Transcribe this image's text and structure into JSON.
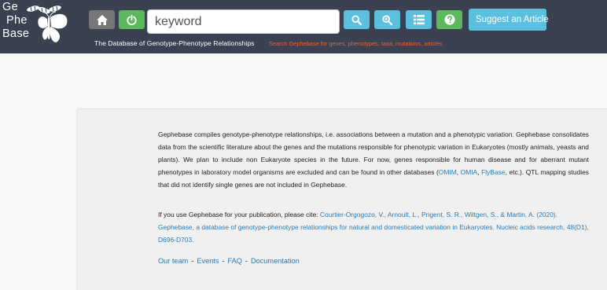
{
  "logo": {
    "line1": "Ge",
    "line2": "Phe",
    "line3": "Base"
  },
  "header": {
    "subtitle": "The Database of Genotype-Phenotype Relationships",
    "tagline": "Search Gephebase for genes, phenotypes, taxa, mutations, articles",
    "suggest_label": "Suggest an Article"
  },
  "search": {
    "placeholder": "keyword"
  },
  "colors": {
    "header_bg": "#3a4150",
    "info_button": "#5bc0de",
    "success_button": "#5cb85c",
    "default_button": "#777777",
    "tagline": "#f0603a",
    "link": "#2a7ab0"
  },
  "icons": {
    "home": "home-icon",
    "power": "power-icon",
    "search": "search-icon",
    "zoom": "zoom-in-icon",
    "list": "list-icon",
    "help": "question-icon",
    "lightbulb": "lightbulb-icon"
  },
  "intro": {
    "text_before": "Gephebase compiles genotype-phenotype relationships, i.e. associations between a mutation and a phenotypic variation. Gephebase consolidates data from the scientific literature about the genes and the mutations responsible for phenotypic variation in Eukaryotes (mostly animals, yeasts and plants). We plan to include non Eukaryote species in the future. For now, genes responsible for human disease and for aberrant mutant phenotypes in laboratory model organisms are excluded and can be found in other databases (",
    "link_omim": "OMIM",
    "comma1": ", ",
    "link_omia": "OMIA",
    "comma2": ", ",
    "link_flybase": "FlyBase",
    "text_after": ", etc.). QTL mapping studies that did not identify single genes are not included in Gephebase."
  },
  "citation": {
    "prefix": "If you use Gephebase for your publication, please cite: ",
    "link": "Courtier-Orgogozo, V., Arnoult, L., Prigent, S. R., Wiltgen, S., & Martin, A. (2020). Gephebase, a database of genotype-phenotype relationships for natural and domesticated variation in Eukaryotes. Nucleic acids research, 48(D1), D696-D703."
  },
  "footer": {
    "our_team": "Our team",
    "events": "Events",
    "faq": "FAQ",
    "documentation": "Documentation",
    "separator": "-"
  }
}
